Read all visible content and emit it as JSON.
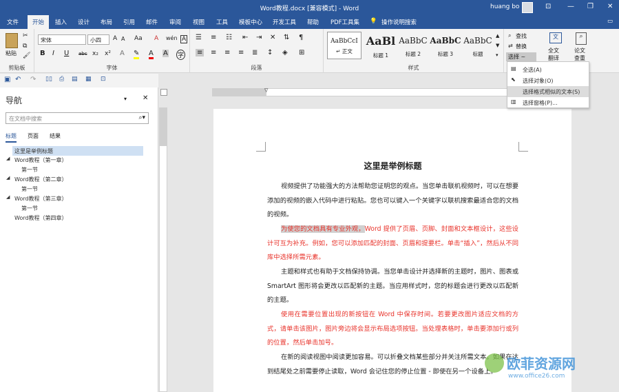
{
  "window": {
    "title": "Word教程.docx [兼容模式] - Word",
    "user_name": "huang bo",
    "controls": {
      "minimize": "—",
      "restore": "❐",
      "close": "✕",
      "ribbon_options": "⊡"
    }
  },
  "tabs": [
    "文件",
    "开始",
    "插入",
    "设计",
    "布局",
    "引用",
    "邮件",
    "审阅",
    "视图",
    "工具",
    "模板中心",
    "开发工具",
    "帮助",
    "PDF工具集"
  ],
  "tell_me": "操作说明搜索",
  "ribbon": {
    "clipboard": {
      "paste_label": "粘贴",
      "group_label": "剪贴板"
    },
    "font": {
      "font_name": "宋体",
      "font_size": "小四",
      "group_label": "字体",
      "aa_label": "Aa",
      "bold": "B",
      "italic": "I",
      "underline": "U",
      "strike": "abc",
      "sub": "x₂",
      "sup": "x²",
      "grow": "A",
      "shrink": "A",
      "clear": "A",
      "wen": "wén",
      "char_border": "A",
      "char_shading": "A",
      "font_color": "A",
      "enclose": "字"
    },
    "paragraph": {
      "group_label": "段落"
    },
    "styles": {
      "group_label": "样式",
      "items": [
        {
          "sample": "AaBbCcI",
          "name": "↵ 正文"
        },
        {
          "sample": "AaBl",
          "name": "标题 1"
        },
        {
          "sample": "AaBbC",
          "name": "标题 2"
        },
        {
          "sample": "AaBbC",
          "name": "标题 3"
        },
        {
          "sample": "AaBbC",
          "name": "标题"
        }
      ]
    },
    "editing": {
      "find": "查找",
      "replace": "替换",
      "select": "选择 ~"
    },
    "translate": {
      "line1": "全文",
      "line2": "翻译"
    },
    "paper_check": {
      "line1": "论文",
      "line2": "查重"
    }
  },
  "select_menu": [
    {
      "label": "全选(A)"
    },
    {
      "label": "选择对象(O)"
    },
    {
      "label": "选择格式相似的文本(S)"
    },
    {
      "label": "选择窗格(P)..."
    }
  ],
  "navigation": {
    "title": "导航",
    "search_placeholder": "在文档中搜索",
    "tabs": [
      "标题",
      "页面",
      "结果"
    ],
    "tree": [
      {
        "label": "这里是举例标题",
        "level": 0,
        "selected": true
      },
      {
        "label": "Word教程（第一章）",
        "level": 0
      },
      {
        "label": "第一节",
        "level": 1
      },
      {
        "label": "Word教程（第二章）",
        "level": 0
      },
      {
        "label": "第一节",
        "level": 1
      },
      {
        "label": "Word教程（第三章）",
        "level": 0
      },
      {
        "label": "第一节",
        "level": 1
      },
      {
        "label": "Word教程（第四章）",
        "level": 0
      }
    ]
  },
  "document": {
    "heading": "这里是举例标题",
    "paragraphs": [
      {
        "text": "视频提供了功能强大的方法帮助您证明您的观点。当您单击联机视频时，可以在想要添加的视频的嵌入代码中进行粘贴。您也可以键入一个关键字以联机搜索最适合您的文档的视频。",
        "color": "black"
      },
      {
        "highlighted": "为使您的文档具有专业外观，",
        "text": "Word 提供了页眉、页脚、封面和文本框设计，这些设计可互为补充。例如，您可以添加匹配的封面、页眉和提要栏。单击“插入”，然后从不同库中选择所需元素。",
        "color": "red"
      },
      {
        "text": "主题和样式也有助于文档保持协调。当您单击设计并选择新的主题时，图片、图表或 SmartArt 图形将会更改以匹配新的主题。当应用样式时，您的标题会进行更改以匹配新的主题。",
        "color": "black"
      },
      {
        "text": "使用在需要位置出现的新按钮在 Word 中保存时间。若要更改图片适应文档的方式，请单击该图片，图片旁边将会显示布局选项按钮。当处理表格时，单击要添加行或列的位置，然后单击加号。",
        "color": "red"
      },
      {
        "text": "在新的阅读视图中阅读更加容易。可以折叠文档某些部分并关注所需文本。如果在达到结尾处之前需要停止读取，Word 会记住您的停止位置 - 即使在另一个设备上。",
        "color": "black"
      }
    ]
  },
  "watermark": {
    "name": "欧菲资源网",
    "url": "www.office26.com"
  },
  "colors": {
    "brand": "#2b579a",
    "red_text": "#e8322a",
    "highlight": "#d0d0d0"
  }
}
